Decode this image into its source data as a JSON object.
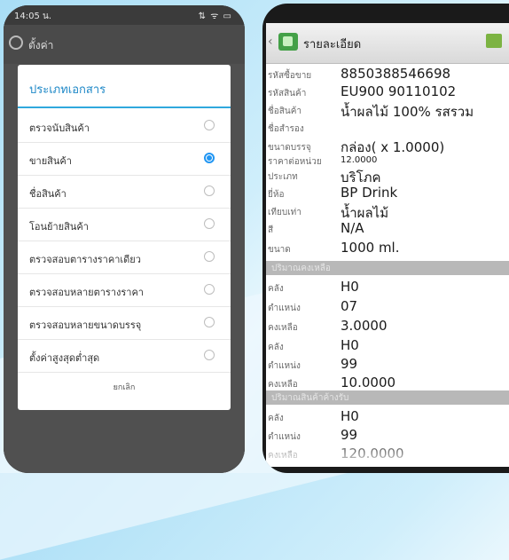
{
  "phone1": {
    "status_time": "14:05 น.",
    "status_icons": "⇅ ᯤ ▭",
    "appbar_title": "ตั้งค่า",
    "dialog": {
      "title": "ประเภทเอกสาร",
      "options": [
        {
          "label": "ตรวจนับสินค้า",
          "selected": false
        },
        {
          "label": "ขายสินค้า",
          "selected": true
        },
        {
          "label": "ชื่อสินค้า",
          "selected": false
        },
        {
          "label": "โอนย้ายสินค้า",
          "selected": false
        },
        {
          "label": "ตรวจสอบตารางราคาเดียว",
          "selected": false
        },
        {
          "label": "ตรวจสอบหลายตารางราคา",
          "selected": false
        },
        {
          "label": "ตรวจสอบหลายขนาดบรรจุ",
          "selected": false
        },
        {
          "label": "ตั้งค่าสูงสุดต่ำสุด",
          "selected": false
        }
      ],
      "cancel_label": "ยกเลิก"
    }
  },
  "phone2": {
    "title": "รายละเอียด",
    "fields": [
      {
        "key": "รหัสซื้อขาย",
        "value": "8850388546698"
      },
      {
        "key": "รหัสสินค้า",
        "value": "EU900 90110102"
      },
      {
        "key": "ชื่อสินค้า",
        "value": "น้ำผลไม้ 100% รสรวม"
      },
      {
        "key": "ชื่อสำรอง",
        "value": ""
      },
      {
        "key": "ขนาดบรรจุ",
        "value": "กล่อง( x 1.0000)"
      },
      {
        "key": "ราคาต่อหน่วย",
        "value": "12.0000"
      },
      {
        "key": "ประเภท",
        "value": "บริโภค"
      },
      {
        "key": "ยี่ห้อ",
        "value": "BP Drink"
      },
      {
        "key": "เทียบเท่า",
        "value": "น้ำผลไม้"
      },
      {
        "key": "สี",
        "value": "N/A"
      },
      {
        "key": "ขนาด",
        "value": "1000 ml."
      }
    ],
    "section1_title": "ปริมาณคงเหลือ",
    "stock1": [
      {
        "key": "คลัง",
        "value": "H0"
      },
      {
        "key": "ตำแหน่ง",
        "value": "07"
      },
      {
        "key": "คงเหลือ",
        "value": "3.0000"
      },
      {
        "key": "คลัง",
        "value": "H0"
      },
      {
        "key": "ตำแหน่ง",
        "value": "99"
      },
      {
        "key": "คงเหลือ",
        "value": "10.0000"
      }
    ],
    "section2_title": "ปริมาณสินค้าค้างรับ",
    "stock2": [
      {
        "key": "คลัง",
        "value": "H0"
      },
      {
        "key": "ตำแหน่ง",
        "value": "99"
      },
      {
        "key": "คงเหลือ",
        "value": "120.0000"
      }
    ]
  },
  "colors": {
    "accent_blue": "#1e88c7",
    "radio_selected": "#2196f3",
    "app_green": "#43a047"
  }
}
